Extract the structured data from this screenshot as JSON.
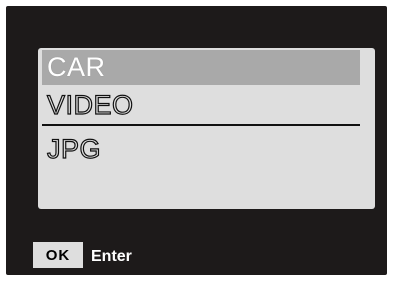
{
  "menu": {
    "items": [
      {
        "label": "CAR",
        "selected": true
      },
      {
        "label": "VIDEO",
        "selected": false
      },
      {
        "label": "JPG",
        "selected": false
      }
    ]
  },
  "footer": {
    "ok_label": "OK",
    "enter_label": "Enter"
  },
  "colors": {
    "screen_background": "#1d1a1a",
    "panel_background": "#dedede",
    "selected_highlight": "#a9a9a9"
  }
}
